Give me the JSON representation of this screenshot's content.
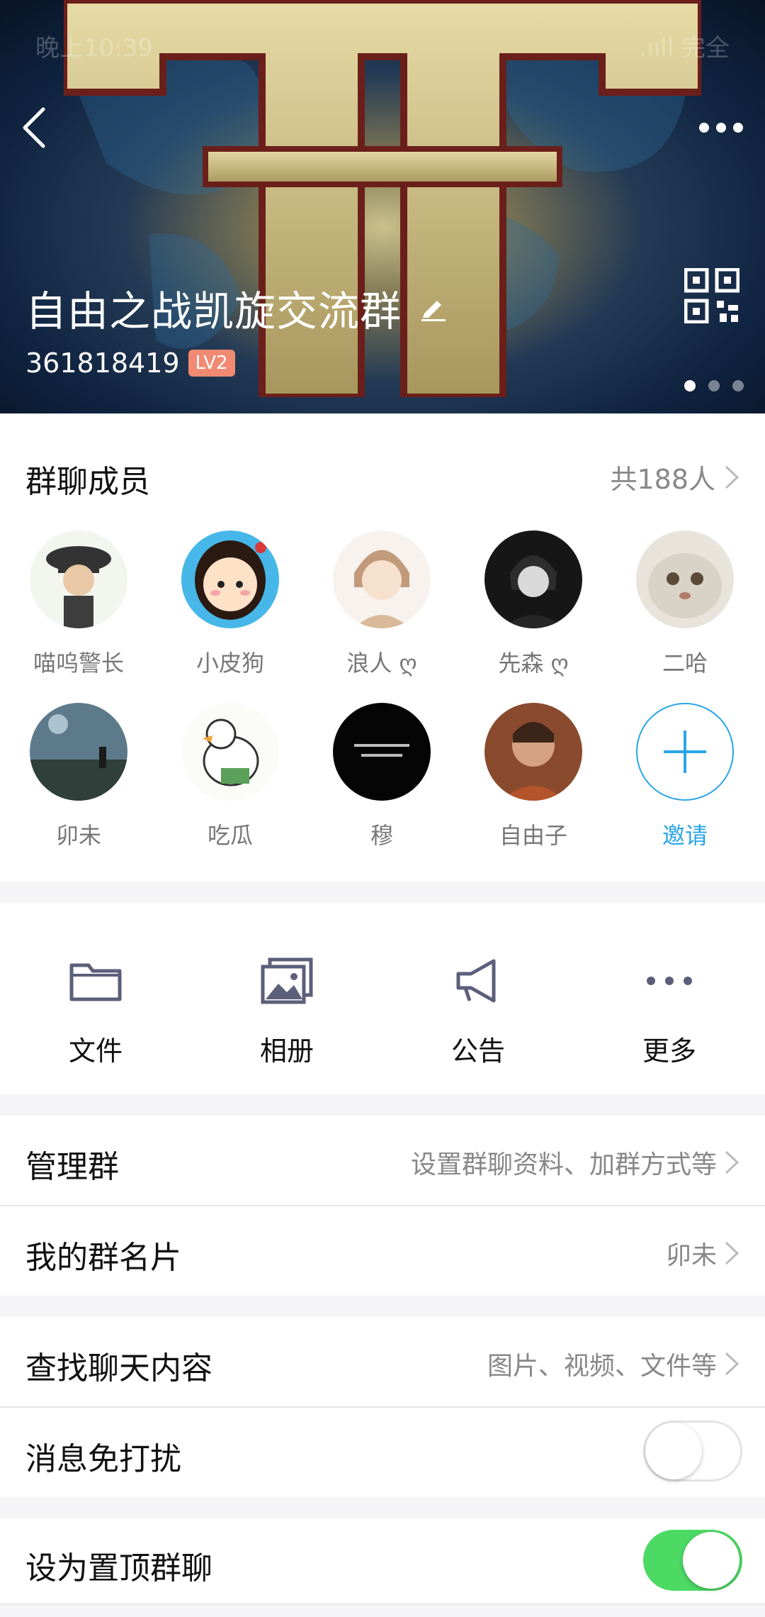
{
  "status_bar": {
    "time": "晚上10:39",
    "right": ".ııll 完全"
  },
  "header": {
    "title": "自由之战凯旋交流群",
    "group_id": "361818419",
    "level": "LV2",
    "colors": {
      "badge": "#f08a73"
    }
  },
  "members": {
    "heading": "群聊成员",
    "count": "共188人",
    "list": [
      {
        "name": "喵呜警长"
      },
      {
        "name": "小皮狗"
      },
      {
        "name": "浪人 ღ"
      },
      {
        "name": "先森 ღ"
      },
      {
        "name": "二哈"
      },
      {
        "name": "卯未"
      },
      {
        "name": "吃瓜"
      },
      {
        "name": "穆"
      },
      {
        "name": "自由子"
      }
    ],
    "invite_label": "邀请",
    "colors": {
      "invite": "#2aa5e6"
    }
  },
  "actions": [
    {
      "label": "文件",
      "icon": "folder-icon"
    },
    {
      "label": "相册",
      "icon": "album-icon"
    },
    {
      "label": "公告",
      "icon": "megaphone-icon"
    },
    {
      "label": "更多",
      "icon": "more-dots-icon"
    }
  ],
  "settings": {
    "manage": {
      "label": "管理群",
      "value": "设置群聊资料、加群方式等"
    },
    "card": {
      "label": "我的群名片",
      "value": "卯未"
    },
    "search": {
      "label": "查找聊天内容",
      "value": "图片、视频、文件等"
    },
    "mute": {
      "label": "消息免打扰",
      "on": false
    },
    "pin": {
      "label": "设为置顶群聊",
      "on": true,
      "color": "#4cd964"
    }
  }
}
